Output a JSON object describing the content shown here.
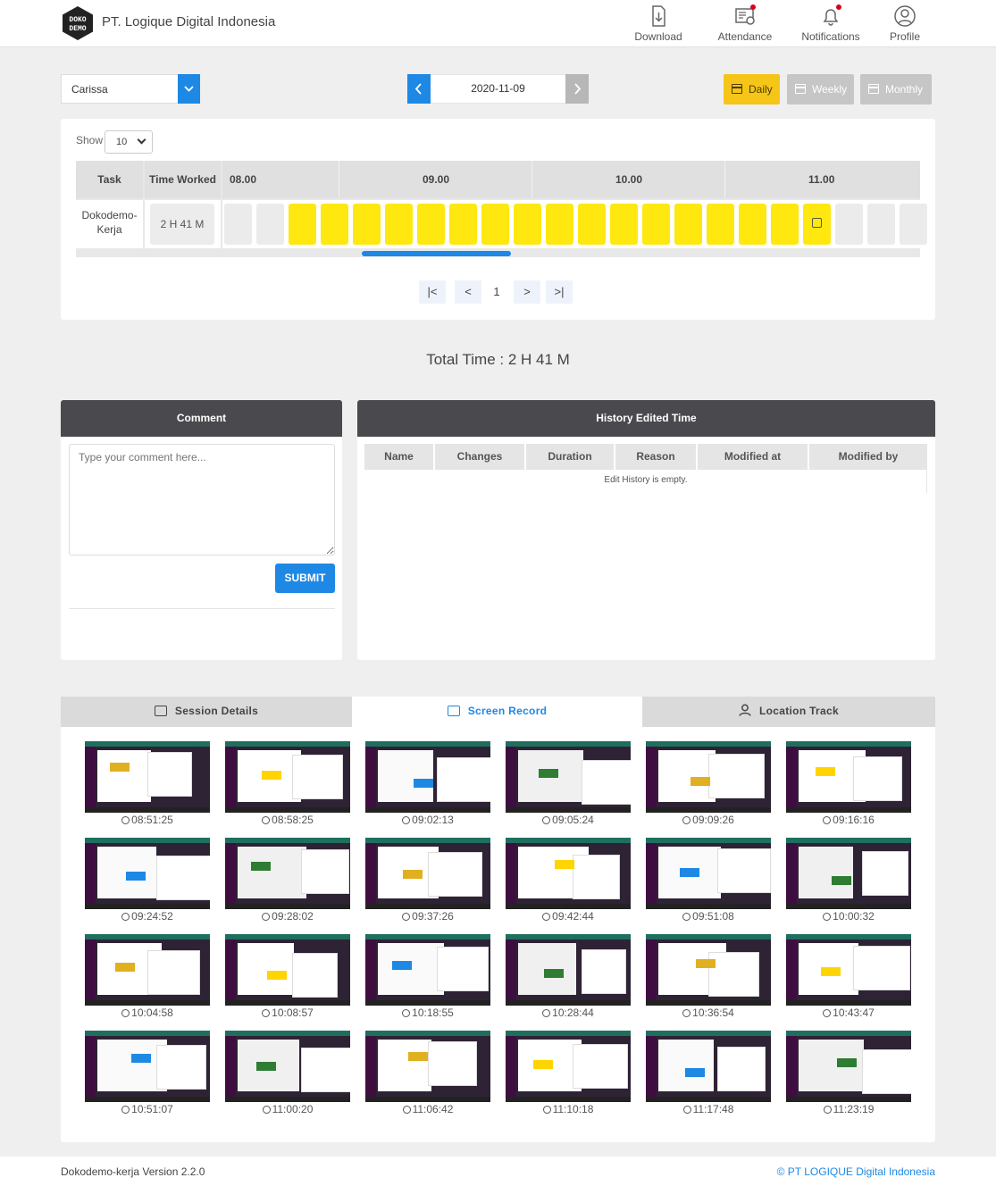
{
  "header": {
    "logo_text": "DOKO DEMO",
    "company": "PT. Logique Digital Indonesia",
    "nav": [
      {
        "label": "Download",
        "icon": "download-icon"
      },
      {
        "label": "Attendance",
        "icon": "attendance-icon"
      },
      {
        "label": "Notifications",
        "icon": "bell-icon"
      },
      {
        "label": "Profile",
        "icon": "user-icon"
      }
    ]
  },
  "filters": {
    "user": "Carissa",
    "date": "2020-11-09",
    "ranges": [
      "Daily",
      "Weekly",
      "Monthly"
    ],
    "active_range": "Daily"
  },
  "timeline": {
    "show_label": "Show",
    "show_value": "10",
    "col_task": "Task",
    "col_time": "Time Worked",
    "hours": [
      "08.00",
      "09.00",
      "10.00",
      "11.00"
    ],
    "row": {
      "task": "Dokodemo-Kerja",
      "time": "2 H 41 M"
    },
    "slots": [
      0,
      0,
      1,
      1,
      1,
      1,
      1,
      1,
      1,
      1,
      1,
      1,
      1,
      1,
      1,
      1,
      1,
      1,
      2,
      0,
      0,
      0
    ],
    "pager": {
      "first": "|<",
      "prev": "<",
      "page": "1",
      "next": ">",
      "last": ">|"
    }
  },
  "total": "Total Time : 2 H 41 M",
  "comment": {
    "title": "Comment",
    "placeholder": "Type your comment here...",
    "submit": "SUBMIT"
  },
  "history": {
    "title": "History Edited Time",
    "columns": [
      "Name",
      "Changes",
      "Duration",
      "Reason",
      "Modified at",
      "Modified by"
    ],
    "empty": "Edit History is empty."
  },
  "tabs": [
    {
      "label": "Session Details",
      "icon": "session-icon"
    },
    {
      "label": "Screen Record",
      "icon": "screen-icon"
    },
    {
      "label": "Location Track",
      "icon": "location-icon"
    }
  ],
  "active_tab": "Screen Record",
  "screenshots": [
    "08:51:25",
    "08:58:25",
    "09:02:13",
    "09:05:24",
    "09:09:26",
    "09:16:16",
    "09:24:52",
    "09:28:02",
    "09:37:26",
    "09:42:44",
    "09:51:08",
    "10:00:32",
    "10:04:58",
    "10:08:57",
    "10:18:55",
    "10:28:44",
    "10:36:54",
    "10:43:47",
    "10:51:07",
    "11:00:20",
    "11:06:42",
    "11:10:18",
    "11:17:48",
    "11:23:19"
  ],
  "footer": {
    "version": "Dokodemo-kerja Version 2.2.0",
    "copyright": "© PT LOGIQUE Digital Indonesia"
  },
  "colors": {
    "accent": "#1e88e5",
    "active_slot": "#ffe710",
    "daily": "#f5c518",
    "header_dark": "#4a4a4e"
  }
}
